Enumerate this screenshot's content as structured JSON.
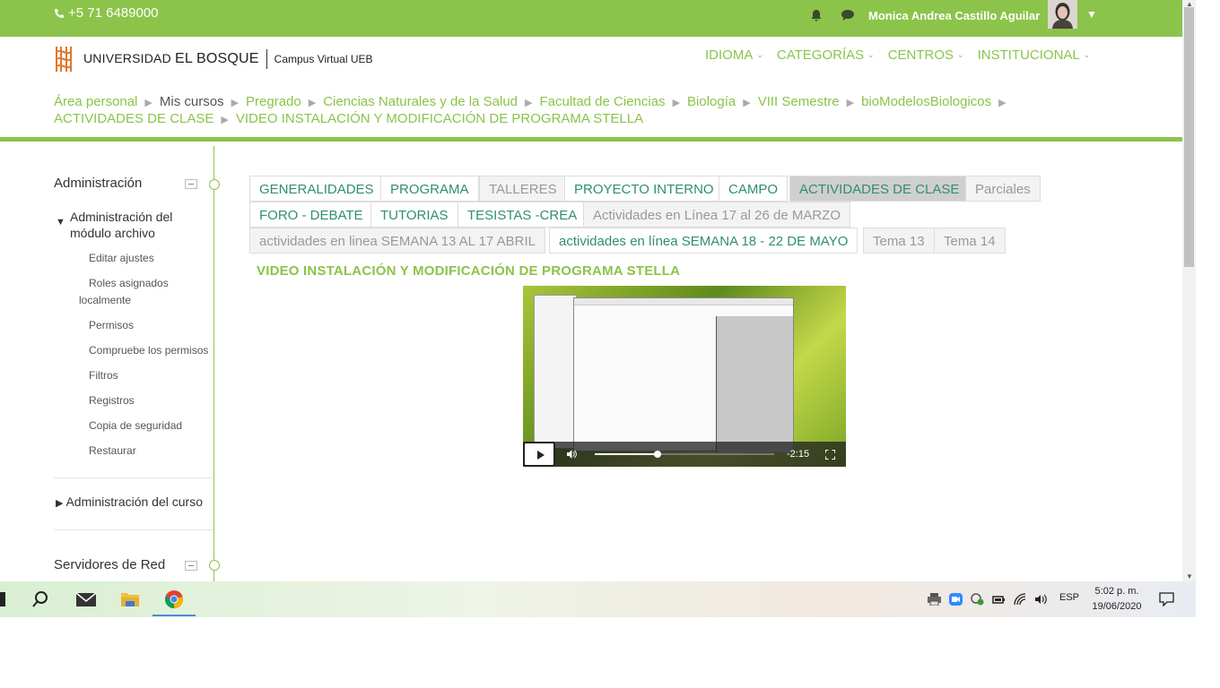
{
  "topbar": {
    "phone": "+5 71 6489000",
    "username": "Monica Andrea Castillo Aguilar"
  },
  "header": {
    "logo_university_prefix": "UNIVERSIDAD",
    "logo_university_name": "EL BOSQUE",
    "logo_campus": "Campus Virtual UEB",
    "nav": [
      {
        "label": "IDIOMA"
      },
      {
        "label": "CATEGORÍAS"
      },
      {
        "label": "CENTROS"
      },
      {
        "label": "INSTITUCIONAL"
      }
    ],
    "breadcrumb": [
      "Área personal",
      "Mis cursos",
      "Pregrado",
      "Ciencias Naturales y de la Salud",
      "Facultad de Ciencias",
      "Biología",
      "VIII Semestre",
      "bioModelosBiologicos",
      "ACTIVIDADES DE CLASE",
      "VIDEO INSTALACIÓN Y MODIFICACIÓN DE PROGRAMA STELLA"
    ]
  },
  "sidebar": {
    "admin_title": "Administración",
    "module_admin": "Administración del módulo archivo",
    "module_items": [
      "Editar ajustes",
      "Roles asignados localmente",
      "Permisos",
      "Compruebe los permisos",
      "Filtros",
      "Registros",
      "Copia de seguridad",
      "Restaurar"
    ],
    "course_admin": "Administración del curso",
    "servers_title": "Servidores de Red"
  },
  "tabs": [
    {
      "label": "GENERALIDADES",
      "state": "normal"
    },
    {
      "label": "PROGRAMA",
      "state": "normal"
    },
    {
      "label": "TALLERES",
      "state": "muted"
    },
    {
      "label": "PROYECTO INTERNO",
      "state": "normal"
    },
    {
      "label": "CAMPO",
      "state": "normal"
    },
    {
      "label": "ACTIVIDADES DE CLASE",
      "state": "active"
    },
    {
      "label": "Parciales",
      "state": "muted"
    },
    {
      "label": "FORO - DEBATE",
      "state": "normal"
    },
    {
      "label": "TUTORIAS",
      "state": "normal"
    },
    {
      "label": "TESISTAS -CREA",
      "state": "normal"
    },
    {
      "label": "Actividades en Línea 17 al 26 de MARZO",
      "state": "muted"
    },
    {
      "label": "actividades en linea SEMANA 13 AL 17 ABRIL",
      "state": "muted"
    },
    {
      "label": "actividades en línea SEMANA 18 - 22 DE MAYO",
      "state": "normal"
    },
    {
      "label": "Tema 13",
      "state": "muted"
    },
    {
      "label": "Tema 14",
      "state": "muted"
    }
  ],
  "content": {
    "title": "VIDEO INSTALACIÓN Y MODIFICACIÓN DE PROGRAMA STELLA"
  },
  "video": {
    "time_remaining": "-2:15",
    "progress": 0.35
  },
  "taskbar": {
    "language": "ESP",
    "time": "5:02 p. m.",
    "date": "19/06/2020"
  },
  "colors": {
    "brand_green": "#8cc34a",
    "tab_text": "#2f8f6f"
  }
}
